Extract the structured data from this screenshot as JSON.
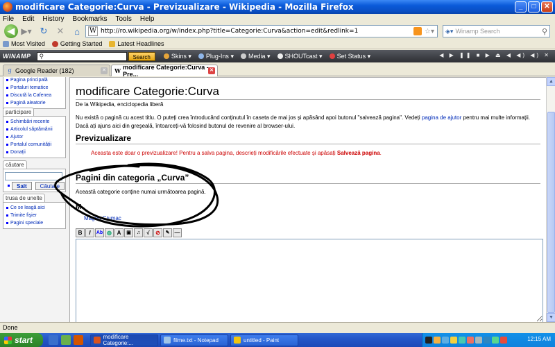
{
  "window": {
    "title": "modificare Categorie:Curva - Previzualizare - Wikipedia - Mozilla Firefox"
  },
  "menu": [
    "File",
    "Edit",
    "History",
    "Bookmarks",
    "Tools",
    "Help"
  ],
  "nav": {
    "url": "http://ro.wikipedia.org/w/index.php?title=Categorie:Curva&action=edit&redlink=1",
    "search_placeholder": "Winamp Search"
  },
  "bookmarks": [
    "Most Visited",
    "Getting Started",
    "Latest Headlines"
  ],
  "winamp": {
    "logo": "WINAMP",
    "search_button": "Search",
    "items": [
      "Skins",
      "Plug-Ins",
      "Media",
      "SHOUTcast",
      "Set Status"
    ]
  },
  "tabs": [
    {
      "label": "Google Reader (182)"
    },
    {
      "label": "modificare Categorie:Curva - Pre..."
    }
  ],
  "sidebar": {
    "top_items": [
      "Pagina principală",
      "Portaluri tematice",
      "Discută la Cafenea",
      "Pagină aleatorie"
    ],
    "participare_title": "participare",
    "participare_items": [
      "Schimbări recente",
      "Articolul săptămânii",
      "Ajutor",
      "Portalul comunității",
      "Donații"
    ],
    "cautare_title": "căutare",
    "salt_label": "Salt",
    "cautare_label": "Căutare",
    "trusa_title": "trusa de unelte",
    "trusa_items": [
      "Ce se leagă aici",
      "Trimite fişier",
      "Pagini speciale"
    ]
  },
  "page": {
    "title": "modificare Categorie:Curva",
    "subtitle": "De la Wikipedia, enciclopedia liberă",
    "notice_1": "Nu există o pagină cu acest titlu. O puteți crea întroducând conținutul în caseta de mai jos și apăsând apoi butonul \"salvează pagina\". Vedeți ",
    "notice_link": "pagina de ajutor",
    "notice_2": " pentru mai multe informații. Dacă ați ajuns aici din greşeală, întoarceți-vă folosind butonul de revenire al browser-ului.",
    "preview_heading": "Previzualizare",
    "warning_text": "Aceasta este doar o previzualizare! Pentru a salva pagina, descrieți modificările efectuate şi apăsați ",
    "warning_bold": "Salvează pagina",
    "warning_end": ".",
    "category_heading": "Pagini din categoria „Curva”",
    "category_text": "Această categorie conține numai următoarea pagină.",
    "letter": "M",
    "member": "Magda Ciumac"
  },
  "toolbar_icons": [
    "bold-icon",
    "italic-icon",
    "link-icon",
    "globe-icon",
    "headline-icon",
    "image-icon",
    "media-icon",
    "math-icon",
    "nowiki-icon",
    "signature-icon",
    "hr-icon"
  ],
  "status": "Done",
  "taskbar": {
    "start": "start",
    "tasks": [
      "modificare Categorie:...",
      "filme.txt - Notepad",
      "untitled - Paint"
    ],
    "clock": "12:15 AM"
  },
  "colors": {
    "link": "#002bb8",
    "warning": "#cc0000",
    "xp_blue": "#0a4fc4"
  }
}
